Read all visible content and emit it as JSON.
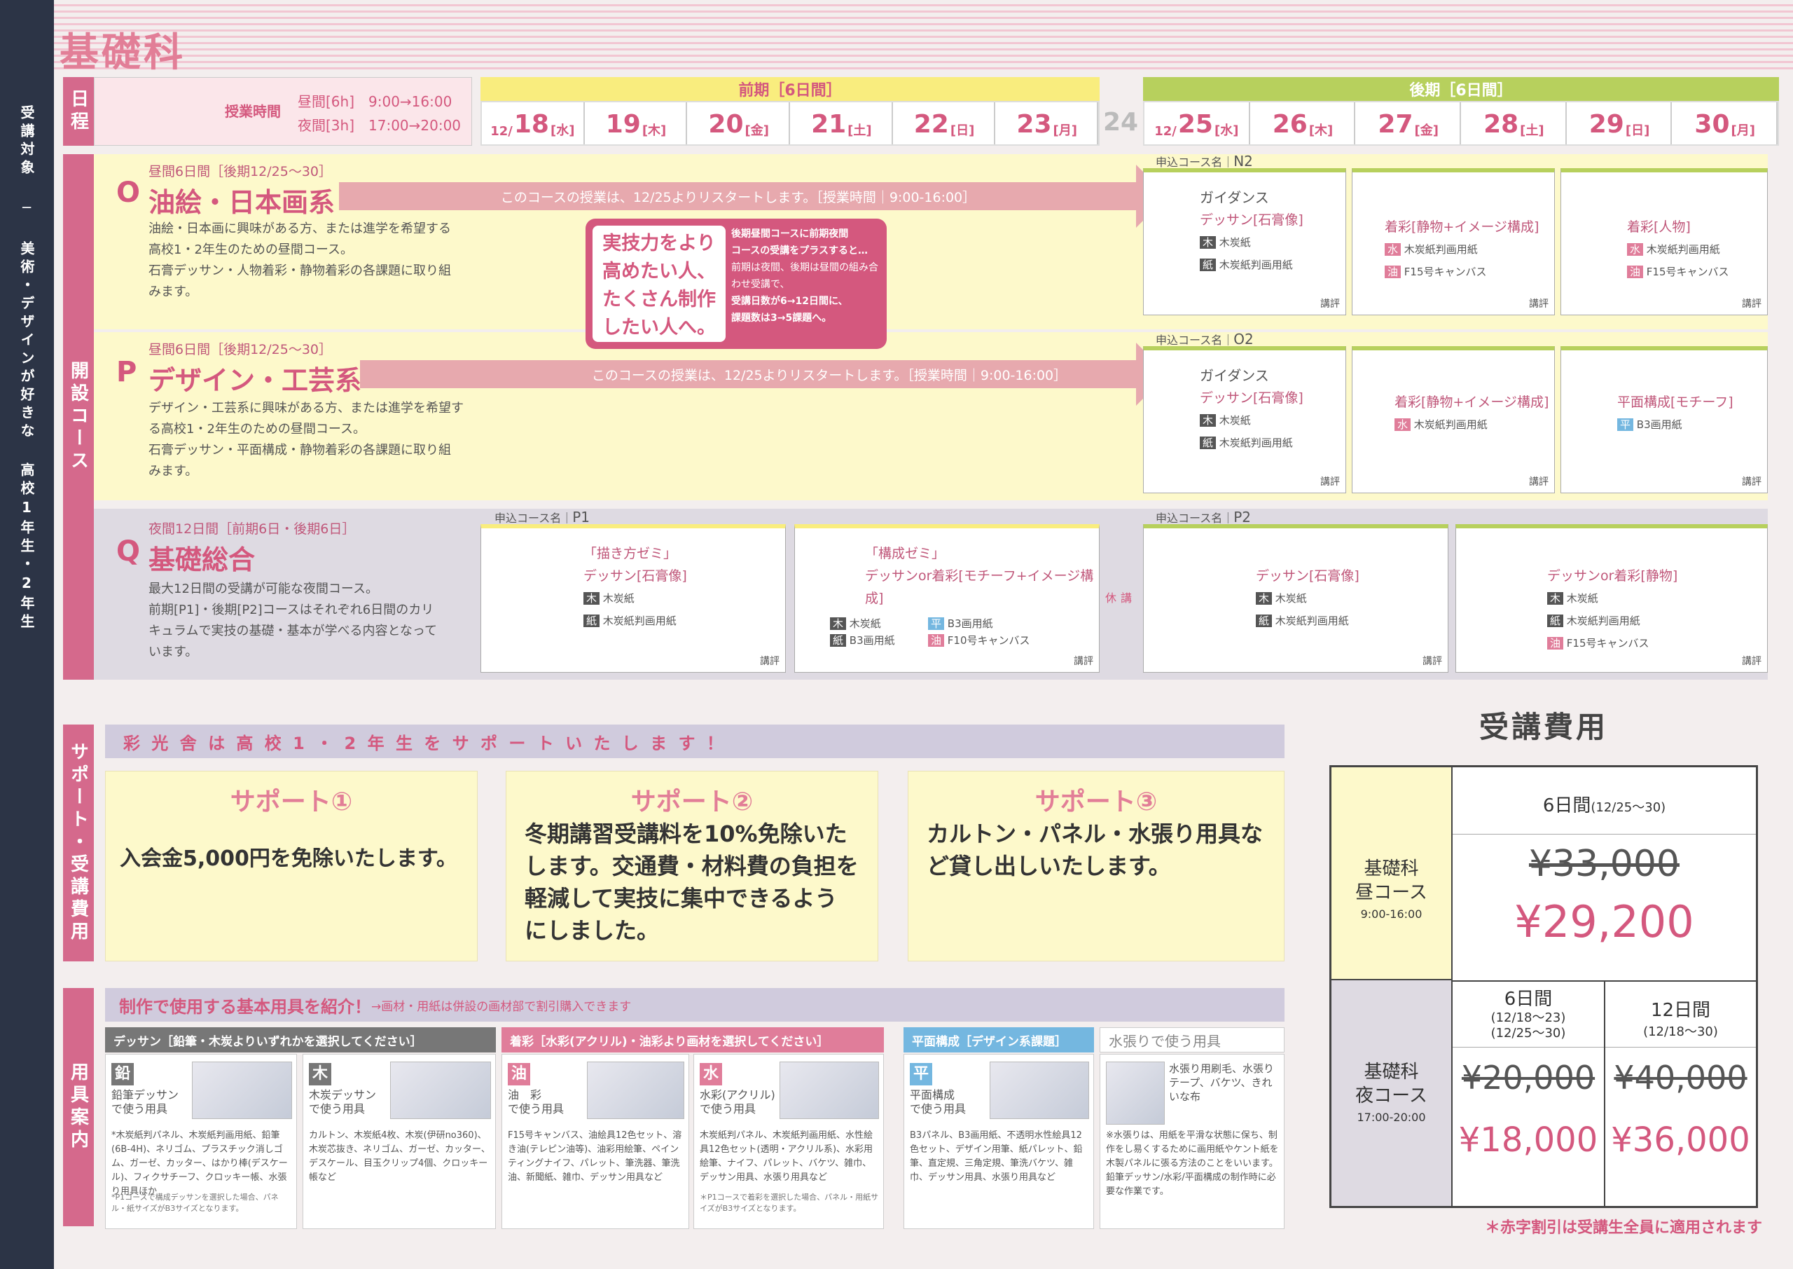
{
  "sidebar": {
    "text": "受講対象 ─ 美術・デザインが好きな 高校1年生・2年生"
  },
  "title": "基礎科",
  "schedule": {
    "label": "日程",
    "time_label": "授業時間",
    "day_time": "昼間[6h]　9:00→16:00",
    "night_time": "夜間[3h]　17:00→20:00",
    "first_term": "前期［6日間］",
    "second_term": "後期［6日間］",
    "first_days": [
      {
        "m": "12/",
        "n": "18",
        "w": "[水]"
      },
      {
        "m": "",
        "n": "19",
        "w": "[木]"
      },
      {
        "m": "",
        "n": "20",
        "w": "[金]"
      },
      {
        "m": "",
        "n": "21",
        "w": "[土]"
      },
      {
        "m": "",
        "n": "22",
        "w": "[日]"
      },
      {
        "m": "",
        "n": "23",
        "w": "[月]"
      }
    ],
    "gap_day": "24",
    "second_days": [
      {
        "m": "12/",
        "n": "25",
        "w": "[水]"
      },
      {
        "m": "",
        "n": "26",
        "w": "[木]"
      },
      {
        "m": "",
        "n": "27",
        "w": "[金]"
      },
      {
        "m": "",
        "n": "28",
        "w": "[土]"
      },
      {
        "m": "",
        "n": "29",
        "w": "[日]"
      },
      {
        "m": "",
        "n": "30",
        "w": "[月]"
      }
    ]
  },
  "courses_label": "開設コース",
  "course_o": {
    "sub": "昼間6日間［後期12/25～30］",
    "letter": "O",
    "name": "油絵・日本画系",
    "desc": [
      "油絵・日本画に興味がある方、または進学を希望する",
      "高校1・2年生のための昼間コース。",
      "石膏デッサン・人物着彩・静物着彩の各課題に取り組",
      "みます。"
    ],
    "arrow": "このコースの授業は、12/25よりリスタートします。［授業時間｜9:00-16:00］",
    "code_label": "申込コース名",
    "code": "N2",
    "cards": [
      {
        "h1": "ガイダンス",
        "h2": "デッサン[石膏像]",
        "items": [
          "木炭紙",
          "木炭紙判画用紙"
        ],
        "k": "講評"
      },
      {
        "h1": "",
        "h2": "着彩[静物+イメージ構成]",
        "items": [
          "木炭紙判画用紙",
          "F15号キャンバス"
        ],
        "k": "講評"
      },
      {
        "h1": "",
        "h2": "着彩[人物]",
        "items": [
          "木炭紙判画用紙",
          "F15号キャンバス"
        ],
        "k": "講評"
      }
    ]
  },
  "course_p": {
    "sub": "昼間6日間［後期12/25～30］",
    "letter": "P",
    "name": "デザイン・工芸系",
    "desc": [
      "デザイン・工芸系に興味がある方、または進学を希望す",
      "る高校1・2年生のための昼間コース。",
      "石膏デッサン・平面構成・静物着彩の各課題に取り組",
      "みます。"
    ],
    "arrow": "このコースの授業は、12/25よりリスタートします。［授業時間｜9:00-16:00］",
    "code_label": "申込コース名",
    "code": "O2",
    "cards": [
      {
        "h1": "ガイダンス",
        "h2": "デッサン[石膏像]",
        "items": [
          "木炭紙",
          "木炭紙判画用紙"
        ],
        "k": "講評"
      },
      {
        "h1": "",
        "h2": "着彩[静物+イメージ構成]",
        "items": [
          "木炭紙判画用紙"
        ],
        "k": "講評"
      },
      {
        "h1": "",
        "h2": "平面構成[モチーフ]",
        "items": [
          "B3画用紙"
        ],
        "k": "講評"
      }
    ]
  },
  "course_q": {
    "sub": "夜間12日間［前期6日・後期6日］",
    "letter": "Q",
    "name": "基礎総合",
    "desc": [
      "最大12日間の受講が可能な夜間コース。",
      "前期[P1]・後期[P2]コースはそれぞれ6日間のカリ",
      "キュラムで実技の基礎・基本が学べる内容となって",
      "います。"
    ],
    "code_label": "申込コース名",
    "code1": "P1",
    "code2": "P2",
    "rest": "休講",
    "cards": [
      {
        "h1": "「描き方ゼミ」",
        "h2": "デッサン[石膏像]",
        "items": [
          "木炭紙",
          "木炭紙判画用紙"
        ],
        "k": "講評"
      },
      {
        "h1": "「構成ゼミ」",
        "h2": "デッサンor着彩[モチーフ+イメージ構成]",
        "items": [
          "木炭紙",
          "B3画用紙",
          "B3画用紙",
          "F10号キャンバス"
        ],
        "k": "講評"
      },
      {
        "h1": "",
        "h2": "デッサン[石膏像]",
        "items": [
          "木炭紙",
          "木炭紙判画用紙"
        ],
        "k": "講評"
      },
      {
        "h1": "",
        "h2": "デッサンor着彩[静物]",
        "items": [
          "木炭紙",
          "木炭紙判画用紙",
          "F15号キャンバス"
        ],
        "k": "講評"
      }
    ]
  },
  "promo": {
    "left": [
      "実技力をより",
      "高めたい人、",
      "たくさん制作",
      "したい人へ。"
    ],
    "right": [
      "後期昼間コースに前期夜間",
      "コースの受講をプラスすると…",
      "前期は夜間、後期は昼間の組み合",
      "わせ受講で、",
      "受講日数が6→12日間に、",
      "課題数は3→5課題へ。"
    ]
  },
  "support": {
    "label": "サポート・受講費用",
    "header": "彩 光 舎 は 高 校 1 ・ 2 年 生 を サ ポ ー ト い た し ま す ！",
    "items": [
      {
        "t": "サポート①",
        "b": "入会金5,000円を免除いたします。"
      },
      {
        "t": "サポート②",
        "b": "冬期講習受講料を10%免除いたします。交通費・材料費の負担を軽減して実技に集中できるようにしました。"
      },
      {
        "t": "サポート③",
        "b": "カルトン・パネル・水張り用具など貸し出しいたします。"
      }
    ]
  },
  "fees": {
    "title": "受講費用",
    "day_label": "基礎科\n昼コース",
    "day_time": "9:00-16:00",
    "day_period": "6日間",
    "day_period_sub": "(12/25～30)",
    "day_old": "¥33,000",
    "day_new": "¥29,200",
    "night_label": "基礎科\n夜コース",
    "night_time": "17:00-20:00",
    "night_p1": "6日間",
    "night_p1_sub": "(12/18～23)\n(12/25～30)",
    "night_p2": "12日間",
    "night_p2_sub": "(12/18～30)",
    "night_old1": "¥20,000",
    "night_old2": "¥40,000",
    "night_new1": "¥18,000",
    "night_new2": "¥36,000",
    "note": "＊赤字割引は受講生全員に適用されます"
  },
  "tools": {
    "label": "用具案内",
    "header": "制作で使用する基本用具を紹介！",
    "header_note": "→画材・用紙は併設の画材部で割引購入できます",
    "groups": [
      {
        "h": "デッサン［鉛筆・木炭よりいずれかを選択してください］",
        "color": "#777"
      },
      {
        "h": "着彩［水彩(アクリル)・油彩より画材を選択してください］",
        "color": "#e07d9a"
      },
      {
        "h": "平面構成［デザイン系課題］",
        "color": "#74b7e0"
      },
      {
        "h": "水張りで使う用具",
        "color": "#fff"
      }
    ],
    "items": [
      {
        "ic": "鉛",
        "name": "鉛筆デッサン",
        "sub": "で使う用具",
        "desc": "*木炭紙判パネル、木炭紙判画用紙、鉛筆(6B-4H)、ネリゴム、プラスチック消しゴム、ガーゼ、カッター、はかり棒(デスケール)、フィクサチーフ、クロッキー帳、水張り用具ほか",
        "note": "*P1コースで構成デッサンを選択した場合、パネル・紙サイズがB3サイズとなります。"
      },
      {
        "ic": "木",
        "name": "木炭デッサン",
        "sub": "で使う用具",
        "desc": "カルトン、木炭紙4枚、木炭(伊研no360)、木炭芯抜き、ネリゴム、ガーゼ、カッター、デスケール、目玉クリップ4個、クロッキー帳など",
        "note": ""
      },
      {
        "ic": "油",
        "name": "油　彩",
        "sub": "で使う用具",
        "desc": "F15号キャンバス、油絵具12色セット、溶き油(テレピン油等)、油彩用絵筆、ペインティングナイフ、パレット、筆洗器、筆洗油、新聞紙、雑巾、デッサン用具など",
        "note": ""
      },
      {
        "ic": "水",
        "name": "水彩(アクリル)",
        "sub": "で使う用具",
        "desc": "木炭紙判パネル、木炭紙判画用紙、水性絵具12色セット(透明・アクリル系)、水彩用絵筆、ナイフ、パレット、バケツ、雑巾、デッサン用具、水張り用具など",
        "note": "＊P1コースで着彩を選択した場合、パネル・用紙サイズがB3サイズとなります。"
      },
      {
        "ic": "平",
        "name": "平面構成",
        "sub": "で使う用具",
        "desc": "B3パネル、B3画用紙、不透明水性絵具12色セット、デザイン用筆、紙パレット、鉛筆、直定規、三角定規、筆洗バケツ、雑巾、デッサン用具、水張り用具など",
        "note": ""
      },
      {
        "ic": "",
        "name": "水張り用刷毛、水張りテープ、バケツ、きれいな布",
        "sub": "",
        "desc": "※水張りは、用紙を平滑な状態に保ち、制作をし易くするために画用紙やケント紙を木製パネルに張る方法のことをいいます。鉛筆デッサン/水彩/平面構成の制作時に必要な作業です。",
        "note": ""
      }
    ]
  }
}
